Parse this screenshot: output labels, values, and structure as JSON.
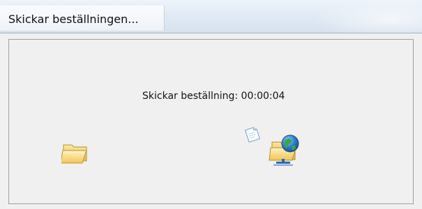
{
  "window": {
    "title": "Skickar beställningen..."
  },
  "content": {
    "status_text": "Skickar beställning: 00:00:04"
  },
  "icons": {
    "source": "folder-open-icon",
    "transfer": "flying-paper-icon",
    "destination": "network-folder-icon"
  },
  "colors": {
    "window_background": "#f0f0f0",
    "frame_border": "#a0a0a0",
    "title_bar": "#dfe8f3",
    "folder_yellow": "#f4d36a",
    "globe_blue": "#2f7fd1",
    "globe_green": "#39a74a"
  }
}
